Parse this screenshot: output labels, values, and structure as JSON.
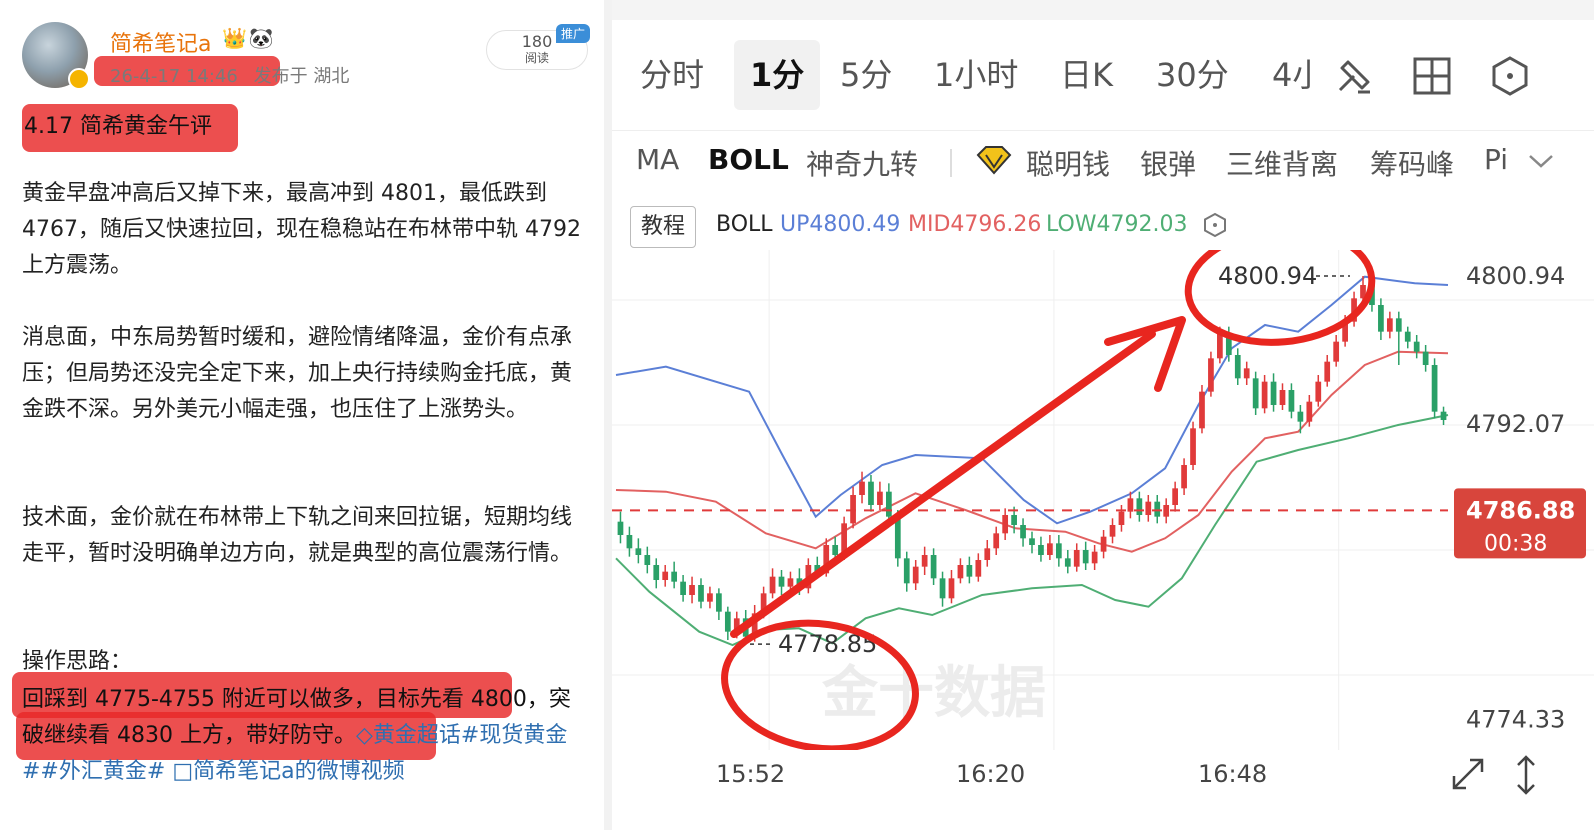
{
  "post": {
    "username": "简希笔记a",
    "name_icons": "👑🐼",
    "timestamp": "26-4-17 14:46",
    "location": "发布于 湖北",
    "read_count": "180",
    "read_label": "阅读",
    "promo_tag": "推广",
    "title": "4.17 简希黄金午评",
    "paragraphs": [
      "黄金早盘冲高后又掉下来，最高冲到 4801，最低跌到 4767，随后又快速拉回，现在稳稳站在布林带中轨 4792 上方震荡。",
      "消息面，中东局势暂时缓和，避险情绪降温，金价有点承压；但局势还没完全定下来，加上央行持续购金托底，黄金跌不深。另外美元小幅走强，也压住了上涨势头。",
      "技术面，金价就在布林带上下轨之间来回拉锯，短期均线走平，暂时没明确单边方向，就是典型的高位震荡行情。"
    ],
    "ops_heading": "操作思路：",
    "ops_text": "回踩到 4775-4755 附近可以做多，目标先看 4800，突破继续看 4830 上方，带好防守。",
    "topic_link": "◇黄金超话",
    "hashtags": "#现货黄金##外汇黄金#",
    "video_link": "□简希笔记a的微博视频"
  },
  "chart_app": {
    "period_tabs": [
      "分时",
      "1分",
      "5分",
      "1小时",
      "日K",
      "30分",
      "4小"
    ],
    "active_tab": "1分",
    "toolbar_icons": [
      "draw-line-icon",
      "layout-grid-icon",
      "settings-hex-icon"
    ],
    "indicators": [
      "MA",
      "BOLL",
      "神奇九转",
      "聪明钱",
      "银弹",
      "三维背离",
      "筹码峰",
      "Pi"
    ],
    "active_indicator": "BOLL",
    "tutorial_label": "教程",
    "boll_name": "BOLL",
    "boll_up": "UP4800.49",
    "boll_mid": "MID4796.26",
    "boll_low": "LOW4792.03",
    "colors": {
      "up": "#5b7fd6",
      "mid": "#e26161",
      "low": "#4fae74",
      "rise": "#e03a3a",
      "fall": "#2aa067",
      "annotation": "#e8261f"
    }
  },
  "chart_data": {
    "type": "candlestick",
    "x_ticks": [
      "15:52",
      "16:20",
      "16:48"
    ],
    "y_ticks": [
      "4800.94",
      "4792.07",
      "4774.33"
    ],
    "ylim": [
      4772.5,
      4802.5
    ],
    "current_price": "4786.88",
    "countdown": "00:38",
    "high_annotation": "4800.94",
    "low_annotation": "4778.85",
    "high_value": 4800.94,
    "low_value": 4778.85,
    "current_value": 4786.88,
    "watermark": "金十数据",
    "candles": [
      [
        4786.2,
        4785.4,
        4786.8,
        4784.9
      ],
      [
        4785.4,
        4784.6,
        4785.9,
        4784.1
      ],
      [
        4784.6,
        4784.2,
        4785.2,
        4783.7
      ],
      [
        4784.2,
        4783.6,
        4784.7,
        4783.1
      ],
      [
        4783.6,
        4782.7,
        4784.0,
        4782.2
      ],
      [
        4782.7,
        4783.2,
        4783.6,
        4782.3
      ],
      [
        4783.2,
        4782.6,
        4783.8,
        4782.2
      ],
      [
        4782.6,
        4781.8,
        4783.0,
        4781.4
      ],
      [
        4781.8,
        4782.4,
        4782.9,
        4781.3
      ],
      [
        4782.4,
        4781.4,
        4782.8,
        4781.0
      ],
      [
        4781.4,
        4781.9,
        4782.3,
        4781.0
      ],
      [
        4781.9,
        4780.8,
        4782.2,
        4780.3
      ],
      [
        4780.8,
        4779.6,
        4781.1,
        4779.1
      ],
      [
        4779.6,
        4780.4,
        4780.8,
        4779.2
      ],
      [
        4780.4,
        4779.3,
        4780.9,
        4779.0
      ],
      [
        4779.3,
        4780.7,
        4781.2,
        4779.0
      ],
      [
        4780.7,
        4781.9,
        4782.3,
        4780.4
      ],
      [
        4781.9,
        4782.9,
        4783.4,
        4781.6
      ],
      [
        4782.9,
        4782.3,
        4783.3,
        4781.8
      ],
      [
        4782.3,
        4782.8,
        4783.2,
        4781.9
      ],
      [
        4782.8,
        4782.2,
        4783.4,
        4781.8
      ],
      [
        4782.2,
        4783.6,
        4784.0,
        4781.9
      ],
      [
        4783.6,
        4783.1,
        4784.1,
        4782.8
      ],
      [
        4783.1,
        4784.8,
        4785.2,
        4782.9
      ],
      [
        4784.8,
        4784.2,
        4785.3,
        4783.8
      ],
      [
        4784.2,
        4786.1,
        4786.5,
        4783.9
      ],
      [
        4786.1,
        4787.8,
        4788.3,
        4785.8
      ],
      [
        4787.8,
        4788.6,
        4789.2,
        4787.3
      ],
      [
        4788.6,
        4787.2,
        4789.0,
        4786.8
      ],
      [
        4787.2,
        4788.0,
        4788.6,
        4786.9
      ],
      [
        4788.0,
        4786.5,
        4788.5,
        4786.1
      ],
      [
        4786.5,
        4784.0,
        4786.9,
        4783.5
      ],
      [
        4784.0,
        4782.5,
        4784.4,
        4782.0
      ],
      [
        4782.5,
        4783.5,
        4783.9,
        4782.1
      ],
      [
        4783.5,
        4784.2,
        4784.7,
        4783.0
      ],
      [
        4784.2,
        4782.8,
        4784.6,
        4782.4
      ],
      [
        4782.8,
        4781.6,
        4783.2,
        4781.1
      ],
      [
        4781.6,
        4782.8,
        4783.3,
        4781.3
      ],
      [
        4782.8,
        4783.6,
        4784.0,
        4782.5
      ],
      [
        4783.6,
        4782.9,
        4784.1,
        4782.5
      ],
      [
        4782.9,
        4783.9,
        4784.3,
        4782.6
      ],
      [
        4783.9,
        4784.6,
        4785.1,
        4783.5
      ],
      [
        4784.6,
        4785.5,
        4785.9,
        4784.2
      ],
      [
        4785.5,
        4786.6,
        4787.0,
        4785.1
      ],
      [
        4786.6,
        4786.0,
        4787.1,
        4785.5
      ],
      [
        4786.0,
        4785.2,
        4786.4,
        4784.7
      ],
      [
        4785.2,
        4784.8,
        4785.6,
        4784.3
      ],
      [
        4784.8,
        4784.2,
        4785.3,
        4783.8
      ],
      [
        4784.2,
        4784.9,
        4785.4,
        4783.9
      ],
      [
        4784.9,
        4784.0,
        4785.4,
        4783.5
      ],
      [
        4784.0,
        4783.5,
        4784.5,
        4783.1
      ],
      [
        4783.5,
        4784.5,
        4784.9,
        4783.2
      ],
      [
        4784.5,
        4783.7,
        4785.0,
        4783.3
      ],
      [
        4783.7,
        4784.4,
        4784.8,
        4783.3
      ],
      [
        4784.4,
        4785.3,
        4785.7,
        4784.0
      ],
      [
        4785.3,
        4786.0,
        4786.4,
        4784.9
      ],
      [
        4786.0,
        4786.8,
        4787.2,
        4785.6
      ],
      [
        4786.8,
        4787.6,
        4788.0,
        4786.4
      ],
      [
        4787.6,
        4786.6,
        4788.0,
        4786.2
      ],
      [
        4786.6,
        4787.4,
        4787.8,
        4786.2
      ],
      [
        4787.4,
        4786.5,
        4787.8,
        4786.1
      ],
      [
        4786.5,
        4787.2,
        4787.6,
        4786.1
      ],
      [
        4787.2,
        4788.2,
        4788.6,
        4786.8
      ],
      [
        4788.2,
        4789.6,
        4790.0,
        4787.8
      ],
      [
        4789.6,
        4791.8,
        4792.2,
        4789.3
      ],
      [
        4791.8,
        4794.0,
        4794.4,
        4791.5
      ],
      [
        4794.0,
        4796.0,
        4796.4,
        4793.7
      ],
      [
        4796.0,
        4797.5,
        4797.9,
        4795.7
      ],
      [
        4797.5,
        4796.2,
        4797.9,
        4795.8
      ],
      [
        4796.2,
        4794.8,
        4796.6,
        4794.4
      ],
      [
        4794.8,
        4795.4,
        4795.8,
        4794.4
      ],
      [
        4794.8,
        4793.0,
        4795.2,
        4792.6
      ],
      [
        4793.0,
        4794.6,
        4795.0,
        4792.7
      ],
      [
        4794.6,
        4793.2,
        4795.1,
        4792.8
      ],
      [
        4793.2,
        4794.1,
        4794.5,
        4792.9
      ],
      [
        4794.1,
        4792.8,
        4794.5,
        4792.4
      ],
      [
        4792.8,
        4792.2,
        4793.2,
        4791.5
      ],
      [
        4792.2,
        4793.4,
        4793.8,
        4791.9
      ],
      [
        4793.4,
        4794.6,
        4795.0,
        4793.1
      ],
      [
        4794.6,
        4795.8,
        4796.2,
        4794.3
      ],
      [
        4795.8,
        4797.0,
        4797.4,
        4795.5
      ],
      [
        4797.0,
        4798.2,
        4798.6,
        4796.7
      ],
      [
        4798.2,
        4799.6,
        4800.0,
        4797.9
      ],
      [
        4799.6,
        4800.4,
        4800.94,
        4799.3
      ],
      [
        4800.4,
        4799.2,
        4800.8,
        4798.8
      ],
      [
        4799.2,
        4797.6,
        4799.6,
        4797.1
      ],
      [
        4797.6,
        4798.4,
        4798.8,
        4797.2
      ],
      [
        4798.4,
        4797.6,
        4798.8,
        4795.6
      ],
      [
        4797.6,
        4797.0,
        4797.9,
        4796.6
      ],
      [
        4797.0,
        4796.4,
        4797.4,
        4796.0
      ],
      [
        4796.4,
        4795.6,
        4796.8,
        4795.2
      ],
      [
        4795.6,
        4792.8,
        4796.0,
        4792.4
      ],
      [
        4792.8,
        4792.3,
        4793.1,
        4792.0
      ]
    ],
    "boll_up": [
      [
        0,
        4795.0
      ],
      [
        0.06,
        4795.5
      ],
      [
        0.16,
        4794.0
      ],
      [
        0.2,
        4790.2
      ],
      [
        0.24,
        4786.5
      ],
      [
        0.27,
        4787.8
      ],
      [
        0.32,
        4789.6
      ],
      [
        0.36,
        4790.2
      ],
      [
        0.44,
        4790.0
      ],
      [
        0.49,
        4787.5
      ],
      [
        0.53,
        4786.1
      ],
      [
        0.57,
        4786.8
      ],
      [
        0.62,
        4787.9
      ],
      [
        0.66,
        4789.4
      ],
      [
        0.7,
        4793.2
      ],
      [
        0.74,
        4796.6
      ],
      [
        0.78,
        4798.0
      ],
      [
        0.82,
        4797.6
      ],
      [
        0.86,
        4799.2
      ],
      [
        0.9,
        4800.9
      ],
      [
        0.96,
        4800.5
      ],
      [
        1.0,
        4800.4
      ]
    ],
    "boll_mid": [
      [
        0,
        4788.1
      ],
      [
        0.06,
        4788.0
      ],
      [
        0.12,
        4787.4
      ],
      [
        0.18,
        4785.5
      ],
      [
        0.24,
        4784.6
      ],
      [
        0.3,
        4786.4
      ],
      [
        0.36,
        4787.9
      ],
      [
        0.42,
        4786.9
      ],
      [
        0.48,
        4785.8
      ],
      [
        0.54,
        4785.6
      ],
      [
        0.58,
        4784.9
      ],
      [
        0.62,
        4784.4
      ],
      [
        0.66,
        4785.2
      ],
      [
        0.7,
        4786.6
      ],
      [
        0.74,
        4789.2
      ],
      [
        0.78,
        4791.2
      ],
      [
        0.82,
        4791.6
      ],
      [
        0.86,
        4793.8
      ],
      [
        0.9,
        4795.6
      ],
      [
        0.94,
        4796.4
      ],
      [
        1.0,
        4796.3
      ]
    ],
    "boll_low": [
      [
        0,
        4784.0
      ],
      [
        0.04,
        4782.0
      ],
      [
        0.1,
        4779.6
      ],
      [
        0.14,
        4778.8
      ],
      [
        0.18,
        4779.7
      ],
      [
        0.22,
        4779.8
      ],
      [
        0.26,
        4778.9
      ],
      [
        0.3,
        4780.4
      ],
      [
        0.34,
        4781.0
      ],
      [
        0.38,
        4780.6
      ],
      [
        0.44,
        4781.8
      ],
      [
        0.5,
        4782.2
      ],
      [
        0.56,
        4782.4
      ],
      [
        0.6,
        4781.5
      ],
      [
        0.64,
        4781.1
      ],
      [
        0.68,
        4782.8
      ],
      [
        0.72,
        4786.0
      ],
      [
        0.77,
        4789.8
      ],
      [
        0.82,
        4790.5
      ],
      [
        0.88,
        4791.2
      ],
      [
        0.94,
        4792.0
      ],
      [
        1.0,
        4792.6
      ]
    ]
  }
}
